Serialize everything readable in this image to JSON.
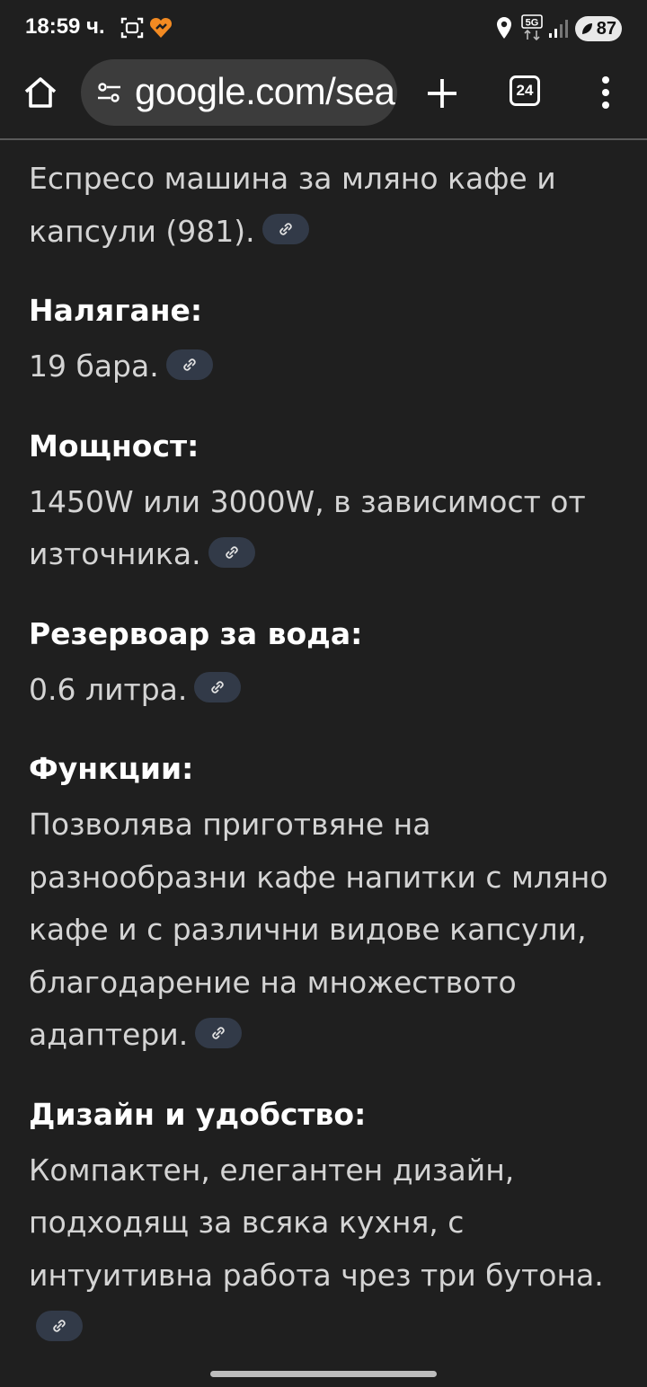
{
  "status_bar": {
    "time": "18:59 ч.",
    "network": "5G",
    "battery": "87",
    "icons": [
      "screenshot-icon",
      "app-notification-icon",
      "location-icon",
      "signal-icon",
      "battery-icon"
    ]
  },
  "toolbar": {
    "url": "google.com/search",
    "tab_count": "24",
    "icons": [
      "home-icon",
      "site-settings-icon",
      "new-tab-icon",
      "tabs-icon",
      "more-menu-icon"
    ]
  },
  "colors": {
    "background": "#1f1f1f",
    "text": "#d4d4d4",
    "heading": "#ffffff",
    "link_chip": "#323a48"
  },
  "content": {
    "intro": "Еспресо машина за мляно кафе и капсули (981).",
    "sections": [
      {
        "heading": "Налягане:",
        "text": "19 бара."
      },
      {
        "heading": "Мощност:",
        "text": "1450W или 3000W, в зависимост от източника."
      },
      {
        "heading": "Резервоар за вода:",
        "text": "0.6 литра."
      },
      {
        "heading": "Функции:",
        "text": "Позволява приготвяне на разнообразни кафе напитки с мляно кафе и с различни видове капсули, благодарение на множеството адаптери."
      },
      {
        "heading": "Дизайн и удобство:",
        "text": "Компактен, елегантен дизайн, подходящ за всяка кухня, с интуитивна работа чрез три бутона."
      }
    ]
  }
}
